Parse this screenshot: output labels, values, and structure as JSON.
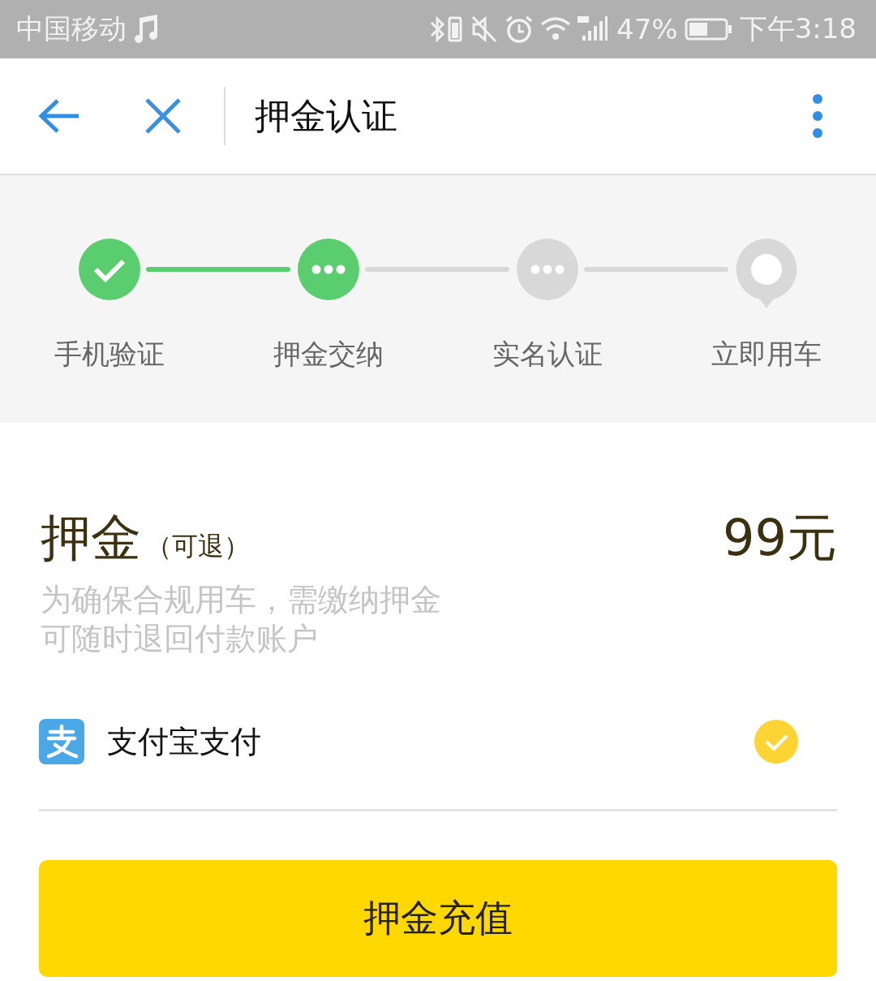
{
  "status_bar": {
    "carrier": "中国移动",
    "battery_percent": "47%",
    "time": "下午3:18"
  },
  "header": {
    "title": "押金认证"
  },
  "steps": [
    {
      "label": "手机验证",
      "kind": "done"
    },
    {
      "label": "押金交纳",
      "kind": "current"
    },
    {
      "label": "实名认证",
      "kind": "pending"
    },
    {
      "label": "立即用车",
      "kind": "final"
    }
  ],
  "deposit": {
    "title": "押金",
    "note": "（可退）",
    "amount": "99元",
    "description": [
      "为确保合规用车，需缴纳押金",
      "可随时退回付款账户"
    ]
  },
  "payment": {
    "label": "支付宝支付",
    "selected": true
  },
  "submit_button": "押金充值"
}
